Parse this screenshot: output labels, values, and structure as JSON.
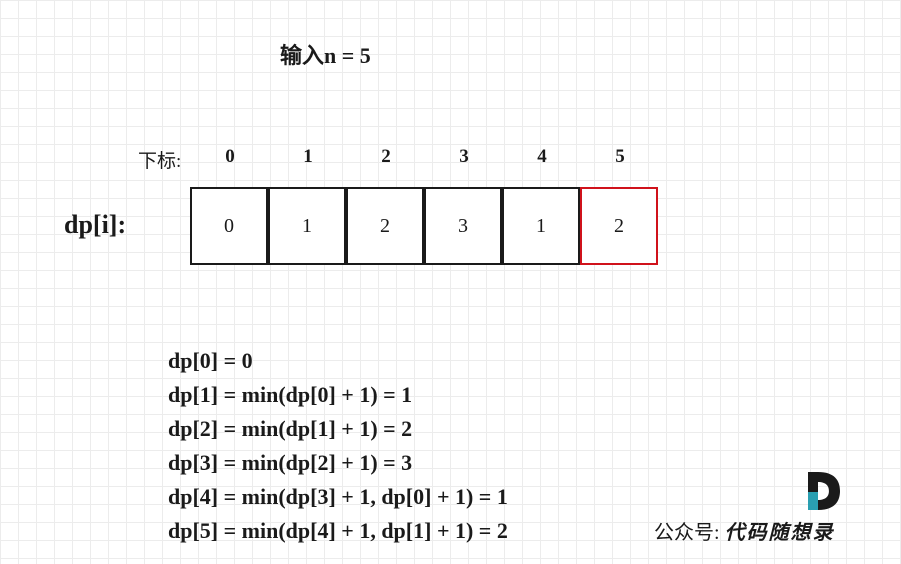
{
  "title": "输入n = 5",
  "index_label": "下标:",
  "indices": [
    "0",
    "1",
    "2",
    "3",
    "4",
    "5"
  ],
  "dp_label": "dp[i]:",
  "cells": [
    "0",
    "1",
    "2",
    "3",
    "1",
    "2"
  ],
  "highlight_index": 5,
  "colors": {
    "highlight": "#d0121b",
    "border": "#1a1a1a",
    "logo_teal": "#2a9fb1"
  },
  "equations": [
    "dp[0] = 0",
    "dp[1] = min(dp[0] + 1) = 1",
    "dp[2] = min(dp[1] + 1) = 2",
    "dp[3] = min(dp[2] + 1) = 3",
    "dp[4] = min(dp[3] + 1, dp[0] + 1) = 1",
    "dp[5] = min(dp[4] + 1, dp[1] + 1) = 2"
  ],
  "brand": {
    "prefix": "公众号:",
    "name": "代码随想录",
    "logo_icon": "d-logo-icon"
  }
}
